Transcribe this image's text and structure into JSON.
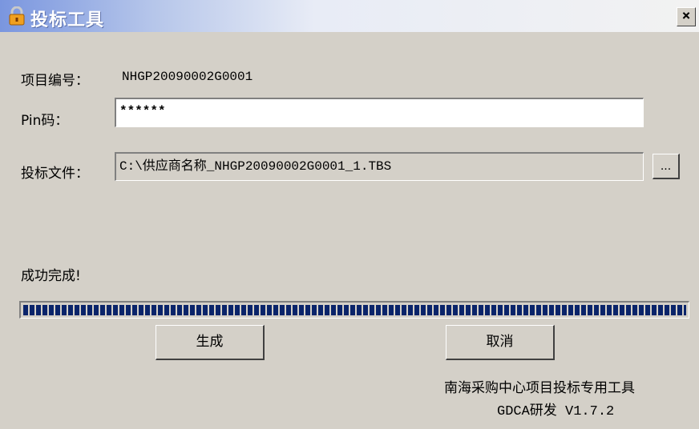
{
  "window": {
    "title": "投标工具",
    "close_label": "×"
  },
  "form": {
    "project_label": "项目编号：",
    "project_value": "NHGP20090002G0001",
    "pin_label": "Pin码：",
    "pin_value": "******",
    "file_label": "投标文件：",
    "file_value": "C:\\供应商名称_NHGP20090002G0001_1.TBS",
    "browse_label": "..."
  },
  "status": {
    "message": "成功完成!"
  },
  "progress": {
    "percent": 100
  },
  "buttons": {
    "generate": "生成",
    "cancel": "取消"
  },
  "footer": {
    "line1": "南海采购中心项目投标专用工具",
    "line2": "GDCA研发 V1.7.2"
  },
  "icons": {
    "title": "lock-icon",
    "close": "close-icon"
  },
  "colors": {
    "progress_fill": "#0a246a",
    "dialog_bg": "#d4d0c8",
    "titlebar_start": "#7a96df"
  }
}
